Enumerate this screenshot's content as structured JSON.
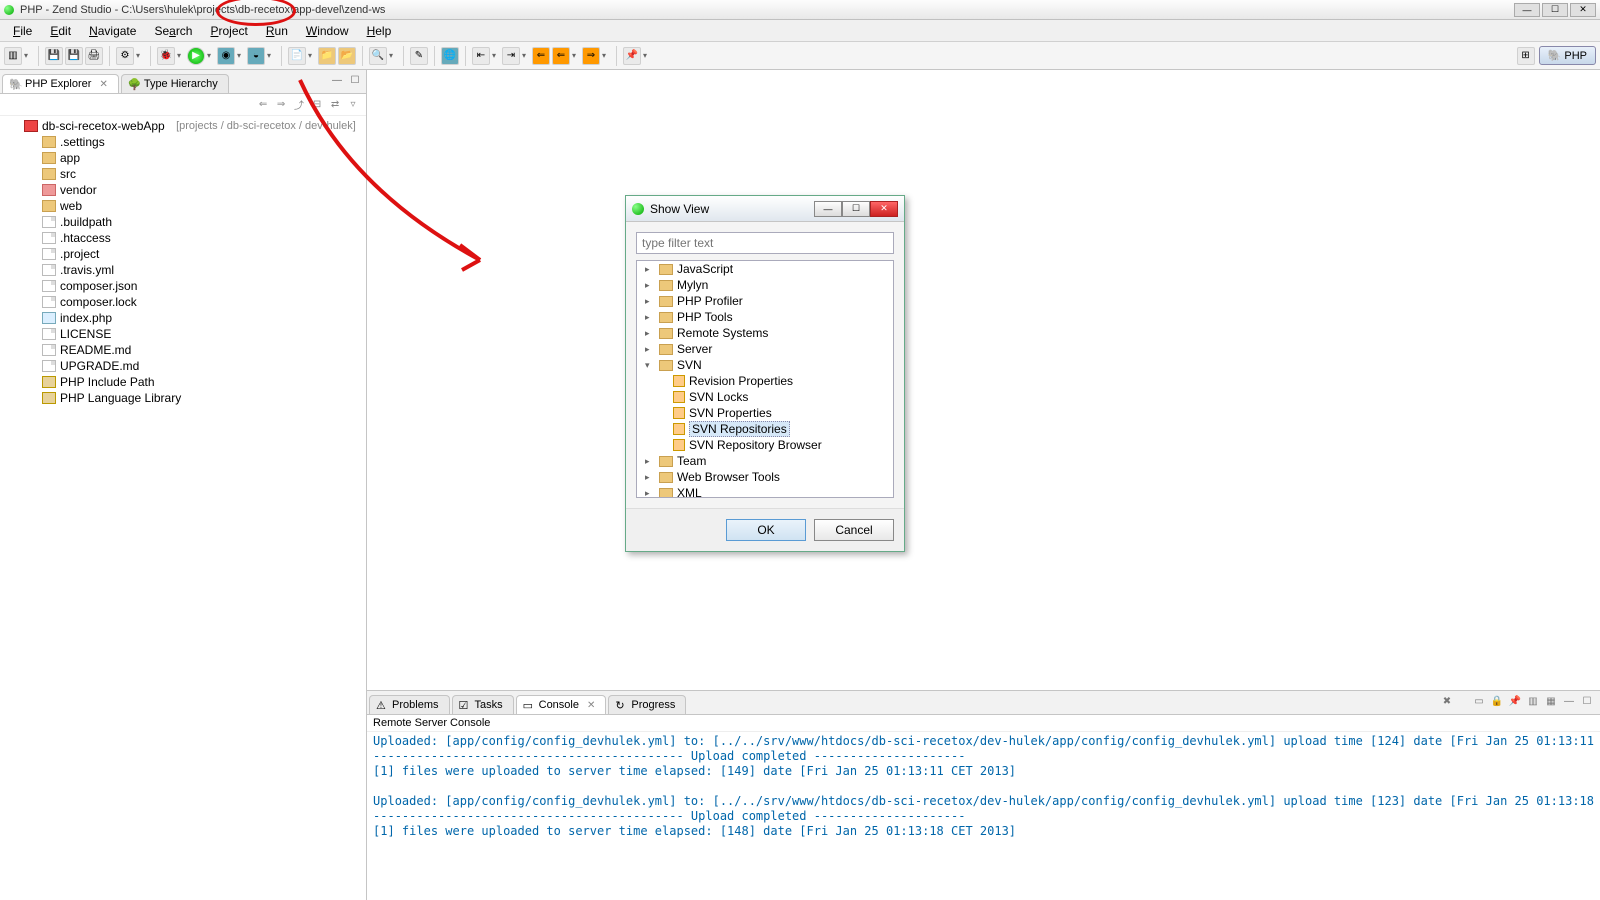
{
  "window": {
    "title": "PHP - Zend Studio - C:\\Users\\hulek\\projects\\db-recetox\\app-devel\\zend-ws"
  },
  "menu": [
    "File",
    "Edit",
    "Navigate",
    "Search",
    "Project",
    "Run",
    "Window",
    "Help"
  ],
  "perspective": {
    "label": "PHP"
  },
  "left_tabs": {
    "explorer": "PHP Explorer",
    "hierarchy": "Type Hierarchy"
  },
  "explorer": {
    "project_name": "db-sci-recetox-webApp",
    "project_repo": "[projects / db-sci-recetox / dev-hulek]",
    "items": [
      {
        "label": ".settings",
        "type": "folder"
      },
      {
        "label": "app",
        "type": "folder"
      },
      {
        "label": "src",
        "type": "folder"
      },
      {
        "label": "vendor",
        "type": "folder-red"
      },
      {
        "label": "web",
        "type": "folder"
      },
      {
        "label": ".buildpath",
        "type": "file"
      },
      {
        "label": ".htaccess",
        "type": "file"
      },
      {
        "label": ".project",
        "type": "file"
      },
      {
        "label": ".travis.yml",
        "type": "file"
      },
      {
        "label": "composer.json",
        "type": "file"
      },
      {
        "label": "composer.lock",
        "type": "file"
      },
      {
        "label": "index.php",
        "type": "php"
      },
      {
        "label": "LICENSE",
        "type": "file"
      },
      {
        "label": "README.md",
        "type": "file"
      },
      {
        "label": "UPGRADE.md",
        "type": "file"
      },
      {
        "label": "PHP Include Path",
        "type": "lib"
      },
      {
        "label": "PHP Language Library",
        "type": "lib"
      }
    ]
  },
  "bottom_tabs": {
    "problems": "Problems",
    "tasks": "Tasks",
    "console": "Console",
    "progress": "Progress"
  },
  "console": {
    "title": "Remote Server Console",
    "lines": [
      "Uploaded: [app/config/config_devhulek.yml] to: [../../srv/www/htdocs/db-sci-recetox/dev-hulek/app/config/config_devhulek.yml] upload time [124] date [Fri Jan 25 01:13:11",
      "------------------------------------------- Upload completed ---------------------",
      "[1] files were uploaded to server time elapsed: [149] date [Fri Jan 25 01:13:11 CET 2013]",
      "",
      "Uploaded: [app/config/config_devhulek.yml] to: [../../srv/www/htdocs/db-sci-recetox/dev-hulek/app/config/config_devhulek.yml] upload time [123] date [Fri Jan 25 01:13:18",
      "------------------------------------------- Upload completed ---------------------",
      "[1] files were uploaded to server time elapsed: [148] date [Fri Jan 25 01:13:18 CET 2013]"
    ]
  },
  "dialog": {
    "title": "Show View",
    "filter_placeholder": "type filter text",
    "ok": "OK",
    "cancel": "Cancel",
    "tree": {
      "folders": [
        "JavaScript",
        "Mylyn",
        "PHP Profiler",
        "PHP Tools",
        "Remote Systems",
        "Server"
      ],
      "svn_label": "SVN",
      "svn_children": [
        "Revision Properties",
        "SVN Locks",
        "SVN Properties",
        "SVN Repositories",
        "SVN Repository Browser"
      ],
      "selected": "SVN Repositories",
      "folders_after": [
        "Team",
        "Web Browser Tools",
        "XML"
      ]
    }
  }
}
